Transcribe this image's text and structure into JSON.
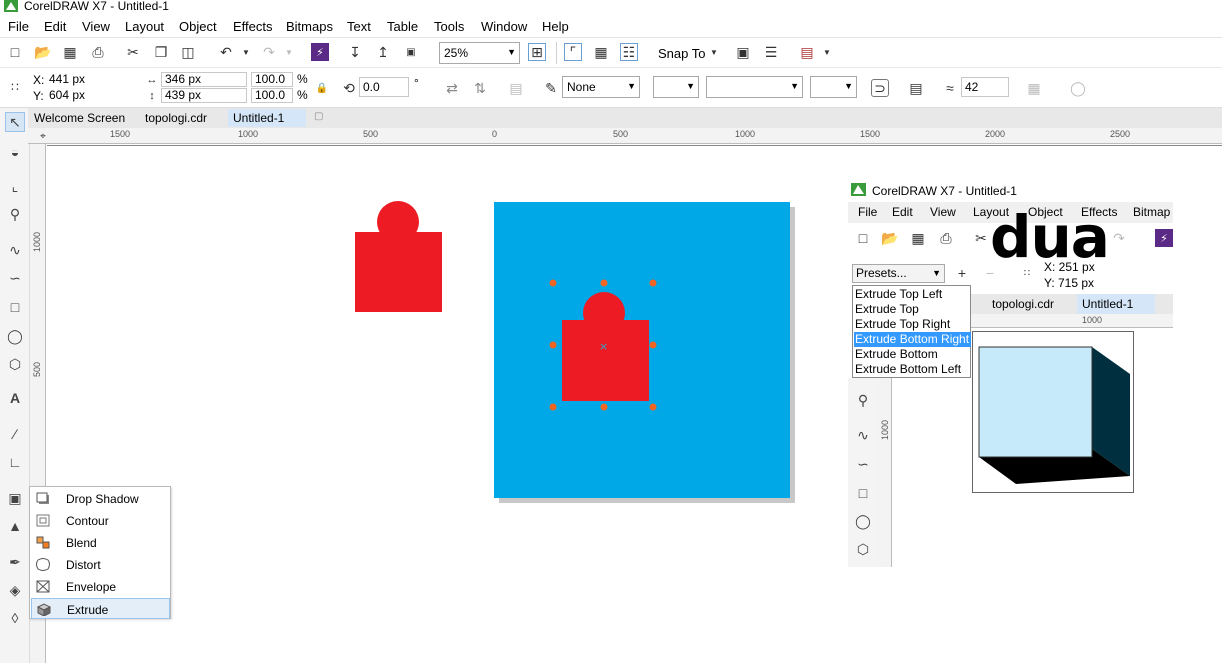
{
  "app": {
    "title": "CorelDRAW X7 - Untitled-1"
  },
  "menu": [
    "File",
    "Edit",
    "View",
    "Layout",
    "Object",
    "Effects",
    "Bitmaps",
    "Text",
    "Table",
    "Tools",
    "Window",
    "Help"
  ],
  "toolbar": {
    "zoom": "25%",
    "snap_to": "Snap To"
  },
  "property_bar": {
    "x_label": "X:",
    "x_value": "441 px",
    "y_label": "Y:",
    "y_value": "604 px",
    "width_value": "346 px",
    "height_value": "439 px",
    "scale_w": "100.0",
    "scale_h": "100.0",
    "percent": "%",
    "rotation": "0.0",
    "degree": "°",
    "fill_none": "None",
    "node_count": "42"
  },
  "document_tabs": [
    "Welcome Screen",
    "topologi.cdr",
    "Untitled-1"
  ],
  "ruler_h": [
    "1500",
    "1000",
    "500",
    "0",
    "500",
    "1000",
    "1500",
    "2000",
    "2500"
  ],
  "ruler_v": [
    "1000",
    "500"
  ],
  "effects_flyout": [
    "Drop Shadow",
    "Contour",
    "Blend",
    "Distort",
    "Envelope",
    "Extrude"
  ],
  "canvas": {
    "colors": {
      "red_shape": "#ed1c24",
      "blue_panel": "#00a8e8",
      "handle": "#f26522",
      "shadow": "#c8c8c8"
    }
  },
  "inset": {
    "title": "CorelDRAW X7 - Untitled-1",
    "menu": [
      "File",
      "Edit",
      "View",
      "Layout",
      "Object",
      "Effects",
      "Bitmap"
    ],
    "presets_label": "Presets...",
    "x_value": "X: 251 px",
    "y_value": "Y: 715 px",
    "tabs": [
      "topologi.cdr",
      "Untitled-1"
    ],
    "ruler_label": "1000",
    "vruler_label": "1000",
    "presets": [
      "Extrude Top Left",
      "Extrude Top",
      "Extrude Top Right",
      "Extrude Bottom Right",
      "Extrude Bottom",
      "Extrude Bottom Left"
    ],
    "overlay_text": "dua",
    "colors": {
      "cube_face": "#c6eaf9",
      "cube_side": "#003040",
      "cube_bottom": "#000000"
    }
  }
}
